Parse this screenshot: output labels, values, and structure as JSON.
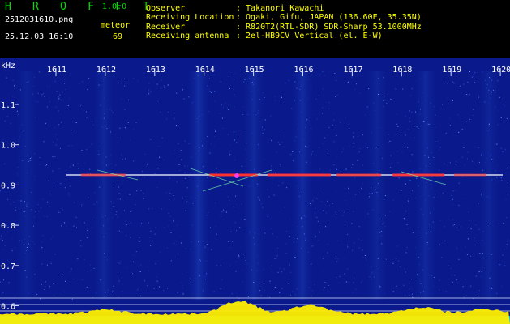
{
  "header": {
    "app_title": "H R O F F T",
    "app_version": "1.0.0",
    "filename": "2512031610.png",
    "meteor_label": "meteor",
    "timestamp": "25.12.03 16:10",
    "meteor_count": "69",
    "info": [
      {
        "key": "Observer",
        "value": ": Takanori Kawachi"
      },
      {
        "key": "Receiving Location",
        "value": ": Ogaki, Gifu, JAPAN (136.60E, 35.35N)"
      },
      {
        "key": "Receiver",
        "value": ": R820T2(RTL-SDR) SDR-Sharp 53.1000MHz"
      },
      {
        "key": "Receiving antenna",
        "value": ": 2el-HB9CV Vertical (el. E-W)"
      }
    ]
  },
  "spectrogram": {
    "unit_label": "kHz",
    "x_ticks": [
      "1611",
      "1612",
      "1613",
      "1614",
      "1615",
      "1616",
      "1617",
      "1618",
      "1619",
      "1620"
    ],
    "y_ticks": [
      "1.1",
      "1.0",
      "0.9",
      "0.8",
      "0.7",
      "0.6"
    ],
    "colors": {
      "background": "#0a1a8c",
      "carrier": "#ffffff",
      "meteor": "#ff3030",
      "envelope": "#ffee00",
      "floor": "#00b8ff",
      "tick_text": "#ffffff"
    }
  }
}
